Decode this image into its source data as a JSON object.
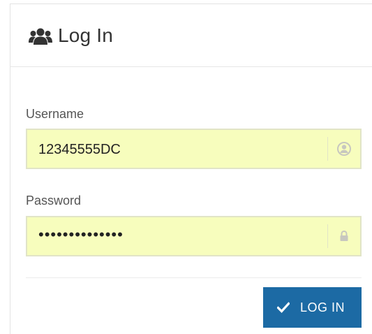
{
  "header": {
    "title": "Log In",
    "icon": "users-icon"
  },
  "username": {
    "label": "Username",
    "value": "12345555DC",
    "icon": "user-circle-icon"
  },
  "password": {
    "label": "Password",
    "value": "••••••••••••••",
    "icon": "lock-icon"
  },
  "submit": {
    "label": "LOG IN",
    "icon": "check-icon"
  },
  "colors": {
    "button": "#1c6aa4",
    "input_background": "#f7fdbd"
  }
}
